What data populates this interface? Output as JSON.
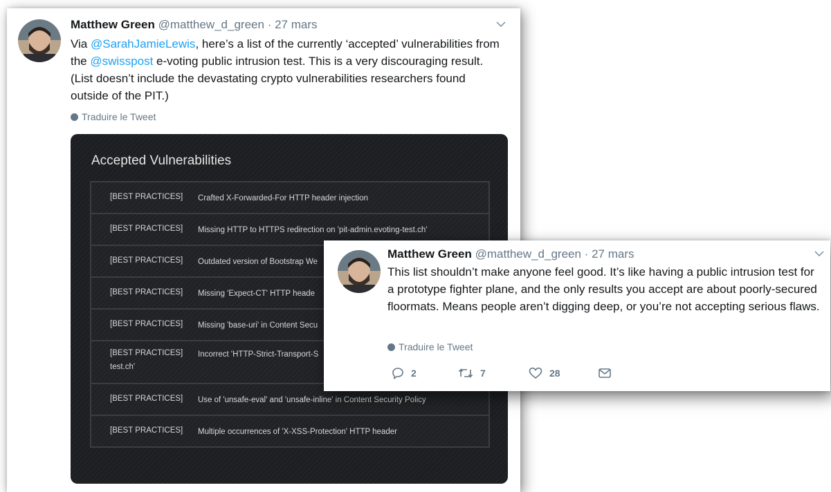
{
  "tweet1": {
    "name": "Matthew Green",
    "handle": "@matthew_d_green",
    "separator": "·",
    "date": "27 mars",
    "text": {
      "t1": "Via ",
      "mention1": "@SarahJamieLewis",
      "t2": ", here’s a list of the currently ‘accepted’ vulnerabilities from the ",
      "mention2": "@swisspost",
      "t3": " e-voting public intrusion test. This is a very discouraging result. (List doesn’t include the devastating crypto vulnerabilities researchers found outside of the PIT.)"
    },
    "translate_label": "Traduire le Tweet",
    "image": {
      "title": "Accepted Vulnerabilities",
      "rows": [
        {
          "tag": "[BEST PRACTICES]",
          "desc": "Crafted X-Forwarded-For HTTP header injection"
        },
        {
          "tag": "[BEST PRACTICES]",
          "desc": "Missing HTTP to HTTPS redirection on 'pit-admin.evoting-test.ch'"
        },
        {
          "tag": "[BEST PRACTICES]",
          "desc": "Outdated version of Bootstrap We"
        },
        {
          "tag": "[BEST PRACTICES]",
          "desc": "Missing 'Expect-CT' HTTP heade"
        },
        {
          "tag": "[BEST PRACTICES]",
          "desc": "Missing 'base-uri' in Content Secu"
        },
        {
          "tag": "[BEST PRACTICES]",
          "desc": "Incorrect 'HTTP-Strict-Transport-S",
          "cont": "test.ch'"
        },
        {
          "tag": "[BEST PRACTICES]",
          "desc": "Use of 'unsafe-eval' and 'unsafe-inline' in Content Security Policy"
        },
        {
          "tag": "[BEST PRACTICES]",
          "desc": "Multiple occurrences of 'X-XSS-Protection' HTTP header"
        }
      ]
    }
  },
  "tweet2": {
    "name": "Matthew Green",
    "handle": "@matthew_d_green",
    "separator": "·",
    "date": "27 mars",
    "text": "This list shouldn’t make anyone feel good. It’s like having a public intrusion test for a prototype fighter plane, and the only results you accept are about poorly-secured floormats. Means people aren’t digging deep, or you’re not accepting serious flaws.",
    "translate_label": "Traduire le Tweet",
    "actions": {
      "reply_count": "2",
      "retweet_count": "7",
      "like_count": "28"
    }
  },
  "colors": {
    "link": "#1da1f2",
    "muted": "#657786",
    "panel_bg": "#1c1e21"
  },
  "icons": [
    "chevron-down-icon",
    "globe-icon",
    "reply-icon",
    "retweet-icon",
    "like-icon",
    "message-icon"
  ]
}
